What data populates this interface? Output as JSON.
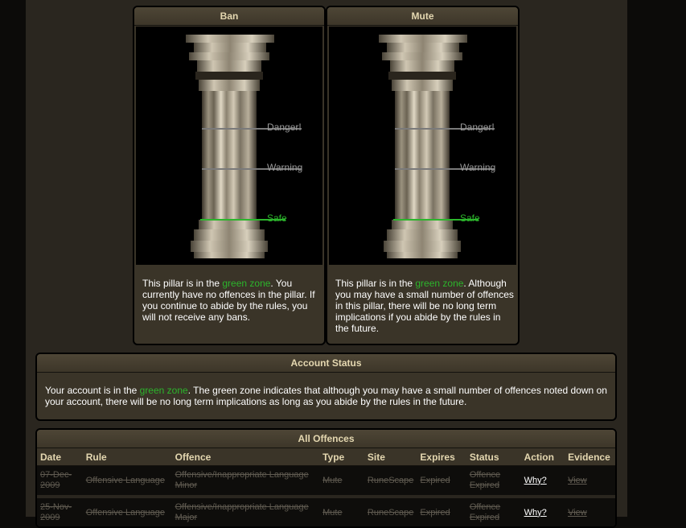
{
  "pillars": [
    {
      "title": "Ban",
      "labels": {
        "danger": "Danger!",
        "warning": "Warning",
        "safe": "Safe"
      },
      "text_prefix": "This pillar is in the ",
      "zone": "green zone",
      "text_suffix": ". You currently have no offences in the pillar. If you continue to abide by the rules, you will not receive any bans."
    },
    {
      "title": "Mute",
      "labels": {
        "danger": "Danger!",
        "warning": "Warning",
        "safe": "Safe"
      },
      "text_prefix": "This pillar is in the ",
      "zone": "green zone",
      "text_suffix": ". Although you may have a small number of offences in this pillar, there will be no long term implications if you abide by the rules in the future."
    }
  ],
  "account_status": {
    "title": "Account Status",
    "text_prefix": "Your account is in the ",
    "zone": "green zone",
    "text_suffix": ". The green zone indicates that although you may have a small number of offences noted down on your account, there will be no long term implications as long as you abide by the rules in the future."
  },
  "offences": {
    "title": "All Offences",
    "columns": [
      "Date",
      "Rule",
      "Offence",
      "Type",
      "Site",
      "Expires",
      "Status",
      "Action",
      "Evidence"
    ],
    "rows": [
      {
        "date": "07-Dec-2009",
        "rule": "Offensive Language",
        "offence": "Offensive/Inappropriate Language Minor",
        "type": "Mute",
        "site": "RuneScape",
        "expires": "Expired",
        "status": "Offence Expired",
        "action": "Why?",
        "evidence": "View"
      },
      {
        "date": "25-Nov-2009",
        "rule": "Offensive Language",
        "offence": "Offensive/Inappropriate Language Major",
        "type": "Mute",
        "site": "RuneScape",
        "expires": "Expired",
        "status": "Offence Expired",
        "action": "Why?",
        "evidence": "View"
      }
    ]
  },
  "colors": {
    "green_zone": "#2cb52c",
    "header_text": "#e4d7b0",
    "panel": "#3a3428"
  }
}
